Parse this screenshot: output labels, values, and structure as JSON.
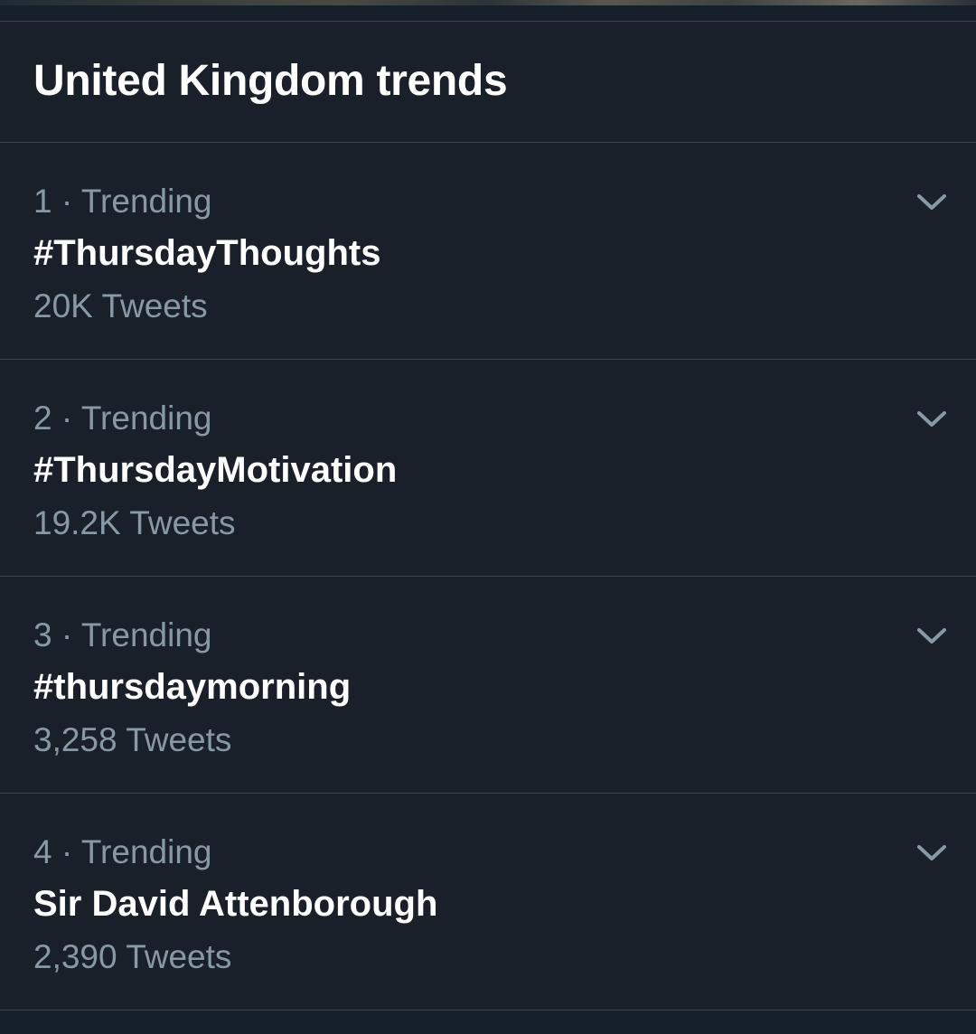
{
  "header": {
    "title": "United Kingdom trends"
  },
  "trends": [
    {
      "rank": "1",
      "separator": "·",
      "context": "Trending",
      "name": "#ThursdayThoughts",
      "tweet_count": "20K Tweets"
    },
    {
      "rank": "2",
      "separator": "·",
      "context": "Trending",
      "name": "#ThursdayMotivation",
      "tweet_count": "19.2K Tweets"
    },
    {
      "rank": "3",
      "separator": "·",
      "context": "Trending",
      "name": "#thursdaymorning",
      "tweet_count": "3,258 Tweets"
    },
    {
      "rank": "4",
      "separator": "·",
      "context": "Trending",
      "name": "Sir David Attenborough",
      "tweet_count": "2,390 Tweets"
    }
  ],
  "icons": {
    "more": "chevron-down-icon"
  },
  "colors": {
    "background": "#15202b",
    "card": "#192029",
    "divider": "#38444d",
    "primary_text": "#ffffff",
    "secondary_text": "#8899a6"
  }
}
